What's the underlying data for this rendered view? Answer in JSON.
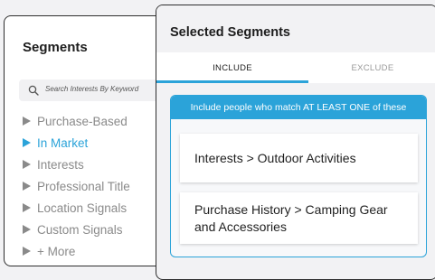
{
  "segments_panel": {
    "title": "Segments",
    "search": {
      "placeholder": "Search Interests By Keyword"
    },
    "items": [
      {
        "label": "Purchase-Based",
        "active": false
      },
      {
        "label": "In Market",
        "active": true
      },
      {
        "label": "Interests",
        "active": false
      },
      {
        "label": "Professional Title",
        "active": false
      },
      {
        "label": "Location Signals",
        "active": false
      },
      {
        "label": "Custom Signals",
        "active": false
      },
      {
        "label": "+ More",
        "active": false
      }
    ]
  },
  "selected_panel": {
    "title": "Selected Segments",
    "tabs": [
      {
        "label": "INCLUDE",
        "active": true
      },
      {
        "label": "EXCLUDE",
        "active": false
      }
    ],
    "include_banner": "Include people who match AT LEAST ONE of these",
    "selected_items": [
      "Interests > Outdoor Activities",
      "Purchase History > Camping Gear and Accessories"
    ]
  },
  "colors": {
    "accent": "#2ba3d9",
    "muted_text": "#8a8a8a",
    "border": "#2e2e2e"
  }
}
